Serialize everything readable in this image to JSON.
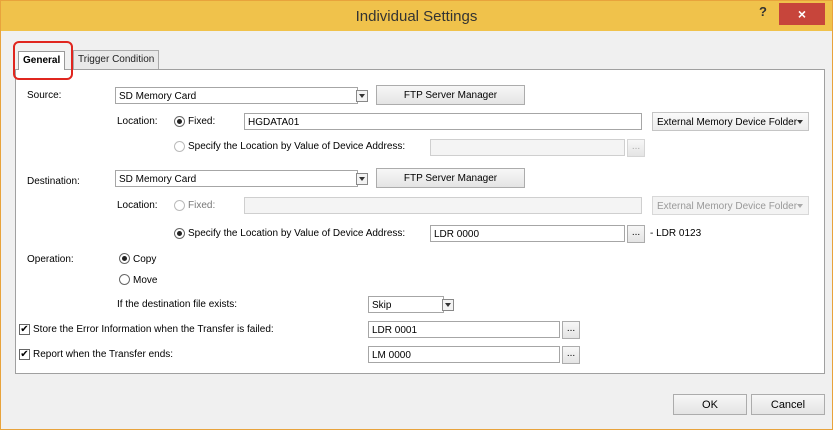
{
  "window": {
    "title": "Individual Settings",
    "help": "?",
    "close": "×"
  },
  "tabs": {
    "general": "General",
    "trigger": "Trigger Condition"
  },
  "source": {
    "label": "Source:",
    "value": "SD Memory Card",
    "ftp": "FTP Server Manager",
    "location_label": "Location:",
    "fixed_label": "Fixed:",
    "fixed_value": "HGDATA01",
    "folder": "External Memory Device Folder",
    "specify_label": "Specify the Location by Value of Device Address:",
    "specify_value": "",
    "browse": "..."
  },
  "destination": {
    "label": "Destination:",
    "value": "SD Memory Card",
    "ftp": "FTP Server Manager",
    "location_label": "Location:",
    "fixed_label": "Fixed:",
    "fixed_value": "",
    "folder": "External Memory Device Folder",
    "specify_label": "Specify the Location by Value of Device Address:",
    "specify_value": "LDR 0000",
    "browse": "...",
    "range_end": "- LDR 0123"
  },
  "operation": {
    "label": "Operation:",
    "copy": "Copy",
    "move": "Move",
    "exists_label": "If the destination file exists:",
    "exists_value": "Skip"
  },
  "error_info": {
    "label": "Store the Error Information when the Transfer is failed:",
    "value": "LDR 0001",
    "browse": "...",
    "checked": true
  },
  "report": {
    "label": "Report when the Transfer ends:",
    "value": "LM 0000",
    "browse": "...",
    "checked": true
  },
  "buttons": {
    "ok": "OK",
    "cancel": "Cancel"
  },
  "check_glyph": "✔"
}
